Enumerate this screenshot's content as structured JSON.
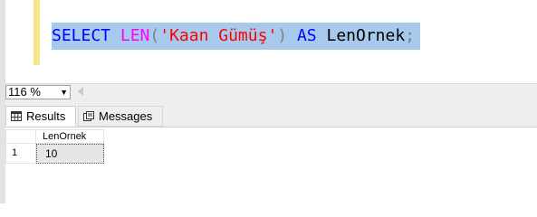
{
  "editor": {
    "tokens": [
      {
        "text": "SELECT",
        "color": "#0000ff"
      },
      {
        "text": " ",
        "color": "#000000"
      },
      {
        "text": "LEN",
        "color": "#ff00ff"
      },
      {
        "text": "(",
        "color": "#808080"
      },
      {
        "text": "'Kaan Gümüş'",
        "color": "#ff0000"
      },
      {
        "text": ")",
        "color": "#808080"
      },
      {
        "text": " ",
        "color": "#000000"
      },
      {
        "text": "AS",
        "color": "#0000ff"
      },
      {
        "text": " LenOrnek",
        "color": "#000000"
      },
      {
        "text": ";",
        "color": "#808080"
      }
    ],
    "selection_color": "#a6c9ec",
    "change_marker_color": "#f7e58b"
  },
  "zoom": {
    "value": "116 %",
    "dropdown_icon": "chevron-down-icon"
  },
  "tabs": [
    {
      "label": "Results",
      "icon": "grid-icon",
      "active": true
    },
    {
      "label": "Messages",
      "icon": "messages-icon",
      "active": false
    }
  ],
  "results": {
    "columns": [
      "LenOrnek"
    ],
    "rows": [
      {
        "row_number": "1",
        "cells": [
          "10"
        ]
      }
    ]
  }
}
